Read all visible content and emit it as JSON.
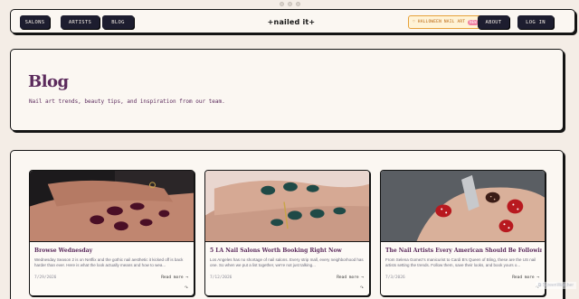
{
  "nav": {
    "left": [
      "SALONS",
      "ARTISTS",
      "BLOG"
    ],
    "logo": "+nailed it+",
    "promo_label": "♡ HALLOWEEN NAIL ART",
    "promo_badge": "NEW",
    "right": [
      "ABOUT",
      "LOG IN"
    ]
  },
  "hero": {
    "title": "Blog",
    "subtitle": "Nail art trends, beauty tips, and inspiration from our team."
  },
  "posts": [
    {
      "title": "Browse Wednesday",
      "excerpt": "Wednesday Season 2 is on Netflix and the gothic nail aesthetic it kicked off is back harder than ever. Here is what the look actually means and how to wea...",
      "date": "7/29/2026",
      "more": "Read more →",
      "share": "↷"
    },
    {
      "title": "5 LA Nail Salons Worth Booking Right Now",
      "excerpt": "Los Angeles has no shortage of nail salons. Every strip mall, every neighborhood has one. So when we put a list together, we're not just talking...",
      "date": "7/12/2026",
      "more": "Read more →",
      "share": "↷"
    },
    {
      "title": "The Nail Artists Every American Should Be Following Right Now",
      "excerpt": "From Selena Gomez's manicurist to Cardi B's Queen of Bling, these are the US nail artists setting the trends. Follow them, save their looks, and book yours o...",
      "date": "7/3/2026",
      "more": "Read more →",
      "share": "↷"
    }
  ],
  "watermark": "⧉ ScreenWatcher",
  "colors": {
    "accent": "#5b2a5c",
    "dark_button": "#1d1d2f",
    "background": "#f4ede6",
    "panel": "#fbf7f2",
    "promo": "#e6a13a"
  }
}
